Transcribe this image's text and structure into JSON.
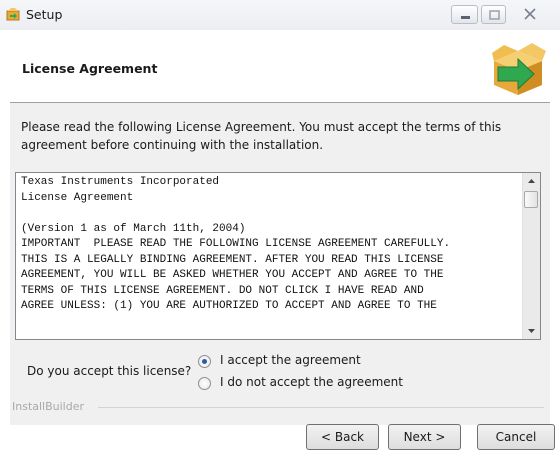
{
  "window": {
    "title": "Setup",
    "minimize_icon": "minimize-icon",
    "maximize_icon": "maximize-icon",
    "close_icon": "close-icon"
  },
  "header": {
    "title": "License Agreement",
    "icon": "install-box-arrow-icon"
  },
  "intro_text": "Please read the following License Agreement. You must accept the terms of this agreement before continuing with the installation.",
  "license_text": "Texas Instruments Incorporated\nLicense Agreement\n\n(Version 1 as of March 11th, 2004)\nIMPORTANT  PLEASE READ THE FOLLOWING LICENSE AGREEMENT CAREFULLY.\nTHIS IS A LEGALLY BINDING AGREEMENT. AFTER YOU READ THIS LICENSE\nAGREEMENT, YOU WILL BE ASKED WHETHER YOU ACCEPT AND AGREE TO THE\nTERMS OF THIS LICENSE AGREEMENT. DO NOT CLICK I HAVE READ AND\nAGREE UNLESS: (1) YOU ARE AUTHORIZED TO ACCEPT AND AGREE TO THE",
  "question": {
    "label": "Do you accept this license?",
    "options": [
      {
        "label": "I accept the agreement",
        "selected": true
      },
      {
        "label": "I do not accept the agreement",
        "selected": false
      }
    ]
  },
  "footer": {
    "brand": "InstallBuilder",
    "back_label": "< Back",
    "next_label": "Next >",
    "cancel_label": "Cancel"
  },
  "colors": {
    "accent_green": "#2fa84f",
    "box_orange": "#e8a93a",
    "radio_selected": "#2d5b9e"
  }
}
